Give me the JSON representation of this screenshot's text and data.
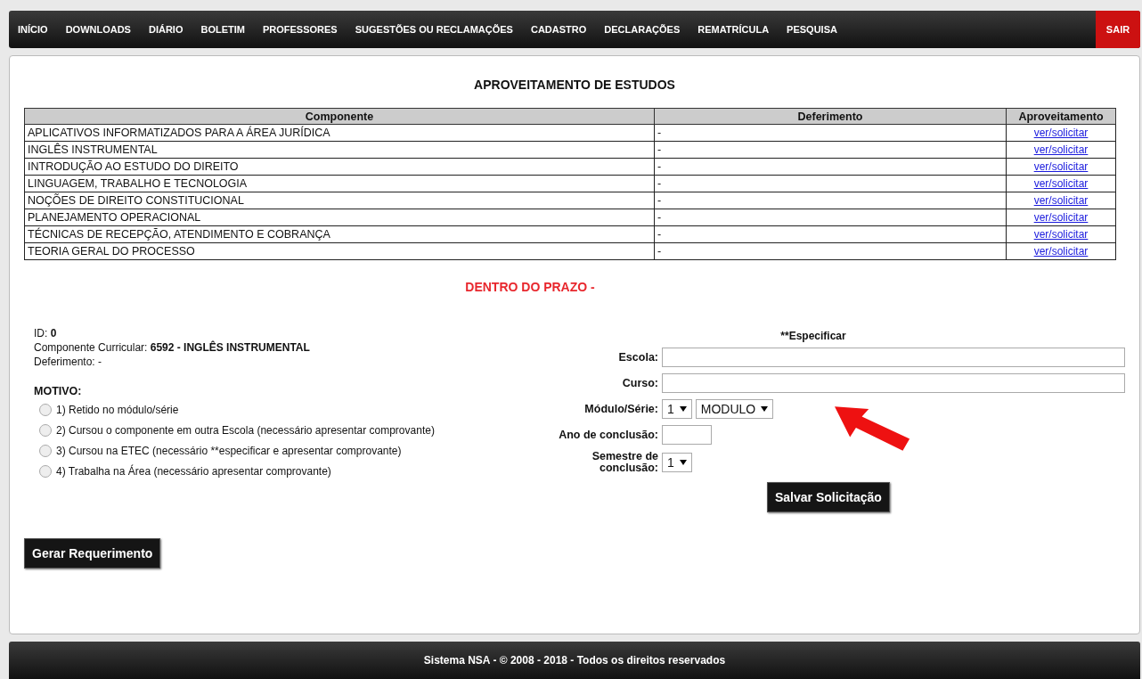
{
  "nav": {
    "items": [
      {
        "label": "INÍCIO"
      },
      {
        "label": "DOWNLOADS"
      },
      {
        "label": "DIÁRIO"
      },
      {
        "label": "BOLETIM"
      },
      {
        "label": "PROFESSORES"
      },
      {
        "label": "SUGESTÕES OU RECLAMAÇÕES"
      },
      {
        "label": "CADASTRO"
      },
      {
        "label": "DECLARAÇÕES"
      },
      {
        "label": "REMATRÍCULA"
      },
      {
        "label": "PESQUISA"
      }
    ],
    "logout": "SAIR"
  },
  "title": "APROVEITAMENTO DE ESTUDOS",
  "table": {
    "columns": [
      "Componente",
      "Deferimento",
      "Aproveitamento"
    ],
    "rows": [
      {
        "componente": "APLICATIVOS INFORMATIZADOS PARA A ÁREA JURÍDICA",
        "deferimento": "-",
        "link": "ver/solicitar"
      },
      {
        "componente": "INGLÊS INSTRUMENTAL",
        "deferimento": "-",
        "link": "ver/solicitar"
      },
      {
        "componente": "INTRODUÇÃO AO ESTUDO DO DIREITO",
        "deferimento": "-",
        "link": "ver/solicitar"
      },
      {
        "componente": "LINGUAGEM, TRABALHO E TECNOLOGIA",
        "deferimento": "-",
        "link": "ver/solicitar"
      },
      {
        "componente": "NOÇÕES DE DIREITO CONSTITUCIONAL",
        "deferimento": "-",
        "link": "ver/solicitar"
      },
      {
        "componente": "PLANEJAMENTO OPERACIONAL",
        "deferimento": "-",
        "link": "ver/solicitar"
      },
      {
        "componente": "TÉCNICAS DE RECEPÇÃO, ATENDIMENTO E COBRANÇA",
        "deferimento": "-",
        "link": "ver/solicitar"
      },
      {
        "componente": "TEORIA GERAL DO PROCESSO",
        "deferimento": "-",
        "link": "ver/solicitar"
      }
    ]
  },
  "deadline": "DENTRO DO PRAZO -",
  "details": [
    "ID: **0**",
    "Componente Curricular: **6592  - INGLÊS INSTRUMENTAL**",
    "Deferimento: -"
  ],
  "motivo": {
    "label": "MOTIVO:",
    "options": [
      {
        "label": "1) Retido no módulo/série",
        "selected": false
      },
      {
        "label": "2) Cursou o componente em outra Escola (necessário apresentar comprovante)",
        "selected": false
      },
      {
        "label": "3) Cursou na ETEC (necessário **especificar e apresentar comprovante)",
        "selected": false
      },
      {
        "label": "4) Trabalha na Área (necessário apresentar comprovante)",
        "selected": false
      }
    ]
  },
  "specify": {
    "heading": "**Especificar",
    "fields": [
      {
        "kind": "text",
        "label": "Escola:"
      },
      {
        "kind": "text",
        "label": "Curso:"
      },
      {
        "kind": "selects",
        "label": "Módulo/Série:",
        "values": [
          "1",
          "MODULO"
        ]
      },
      {
        "kind": "short",
        "label": "Ano de conclusão:"
      },
      {
        "kind": "selects",
        "label": "Semestre de conclusão:",
        "values": [
          "1"
        ]
      }
    ],
    "save": "Salvar Solicitação"
  },
  "generate": "Gerar Requerimento",
  "footer": "Sistema NSA  -  © 2008 - 2018  -  Todos os direitos reservados"
}
